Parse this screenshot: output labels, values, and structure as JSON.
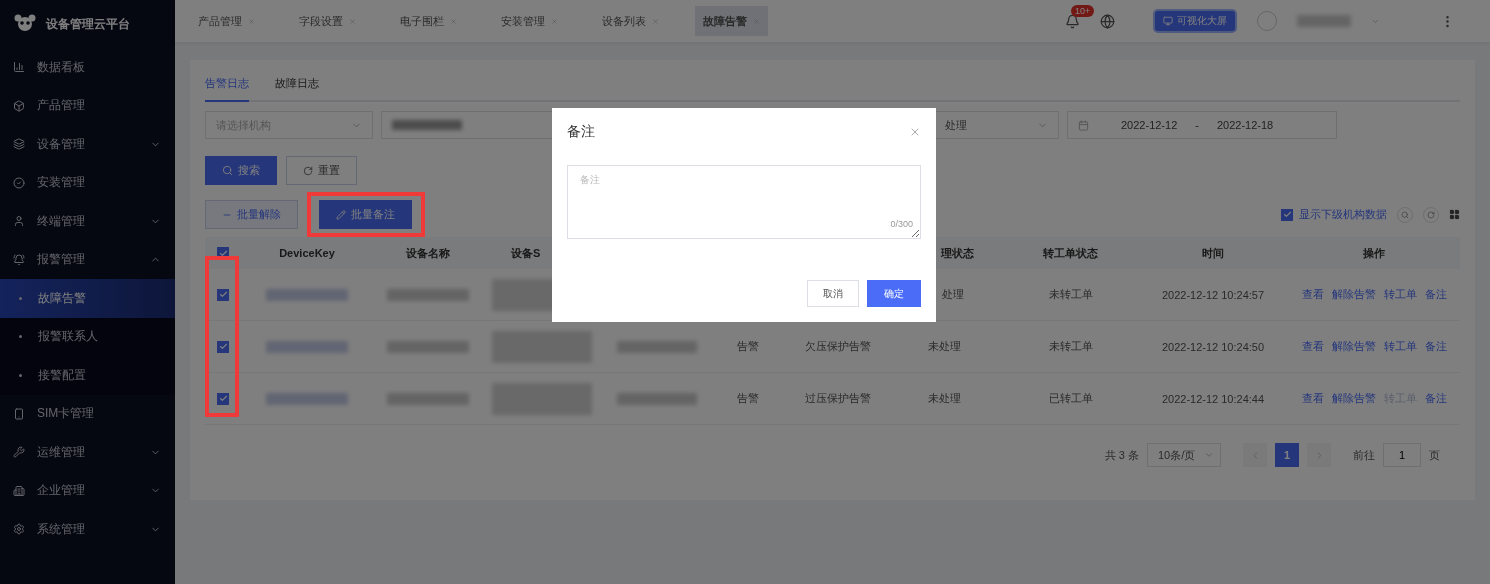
{
  "app": {
    "title": "设备管理云平台"
  },
  "sidebar": {
    "items": [
      {
        "label": "数据看板",
        "selected": false
      },
      {
        "label": "产品管理",
        "selected": false
      },
      {
        "label": "设备管理",
        "selected": false,
        "expanded": false
      },
      {
        "label": "安装管理",
        "selected": false
      },
      {
        "label": "终端管理",
        "selected": false,
        "expanded": false
      },
      {
        "label": "报警管理",
        "selected": false,
        "expanded": true,
        "children": [
          {
            "label": "故障告警",
            "selected": true
          },
          {
            "label": "报警联系人",
            "selected": false
          },
          {
            "label": "接警配置",
            "selected": false
          }
        ]
      },
      {
        "label": "SIM卡管理",
        "selected": false
      },
      {
        "label": "运维管理",
        "selected": false,
        "expanded": false
      },
      {
        "label": "企业管理",
        "selected": false,
        "expanded": false
      },
      {
        "label": "系统管理",
        "selected": false,
        "expanded": false
      }
    ]
  },
  "page_tabs": [
    {
      "label": "产品管理",
      "selected": false
    },
    {
      "label": "字段设置",
      "selected": false
    },
    {
      "label": "电子围栏",
      "selected": false
    },
    {
      "label": "安装管理",
      "selected": false
    },
    {
      "label": "设备列表",
      "selected": false
    },
    {
      "label": "故障告警",
      "selected": true
    }
  ],
  "header": {
    "notification_badge": "10+",
    "screen_button": "可视化大屏"
  },
  "log_tabs": [
    {
      "label": "告警日志",
      "selected": true
    },
    {
      "label": "故障日志",
      "selected": false
    }
  ],
  "filters": {
    "org_placeholder": "请选择机构",
    "status_value": "处理",
    "date_start": "2022-12-12",
    "date_separator": "-",
    "date_end": "2022-12-18"
  },
  "search_buttons": [
    {
      "label": "搜索",
      "kind": "primary"
    },
    {
      "label": "重置",
      "kind": "plain"
    }
  ],
  "batch_buttons": [
    {
      "label": "批量解除",
      "kind": "plain",
      "highlighted": false
    },
    {
      "label": "批量备注",
      "kind": "primary",
      "highlighted": true
    }
  ],
  "show_sub_org": {
    "label": "显示下级机构数据",
    "checked": true
  },
  "table": {
    "all_checked": true,
    "checkbox_column_highlighted": true,
    "columns": [
      "DeviceKey",
      "设备名称",
      "设备S",
      "",
      "",
      "",
      "理状态",
      "转工单状态",
      "时间",
      "操作"
    ],
    "rows": [
      {
        "checked": true,
        "type": "",
        "alarm": "",
        "status": "处理",
        "order_status": "未转工单",
        "time": "2022-12-12 10:24:57",
        "actions": [
          {
            "label": "查看",
            "disabled": false
          },
          {
            "label": "解除告警",
            "disabled": false
          },
          {
            "label": "转工单",
            "disabled": false
          },
          {
            "label": "备注",
            "disabled": false
          }
        ]
      },
      {
        "checked": true,
        "type": "告警",
        "alarm": "欠压保护告警",
        "status": "未处理",
        "order_status": "未转工单",
        "time": "2022-12-12 10:24:50",
        "actions": [
          {
            "label": "查看",
            "disabled": false
          },
          {
            "label": "解除告警",
            "disabled": false
          },
          {
            "label": "转工单",
            "disabled": false
          },
          {
            "label": "备注",
            "disabled": false
          }
        ]
      },
      {
        "checked": true,
        "type": "告警",
        "alarm": "过压保护告警",
        "status": "未处理",
        "order_status": "已转工单",
        "time": "2022-12-12 10:24:44",
        "actions": [
          {
            "label": "查看",
            "disabled": false
          },
          {
            "label": "解除告警",
            "disabled": false
          },
          {
            "label": "转工单",
            "disabled": true
          },
          {
            "label": "备注",
            "disabled": false
          }
        ]
      }
    ]
  },
  "pagination": {
    "total": "共 3 条",
    "page_size": "10条/页",
    "pages": [
      {
        "label": "1",
        "selected": true
      }
    ],
    "goto_label": "前往",
    "goto_value": "1",
    "page_suffix": "页"
  },
  "dialog": {
    "title": "备注",
    "placeholder": "备注",
    "counter": "0/300",
    "buttons": [
      {
        "label": "取消",
        "kind": "plain"
      },
      {
        "label": "确定",
        "kind": "primary"
      }
    ]
  }
}
